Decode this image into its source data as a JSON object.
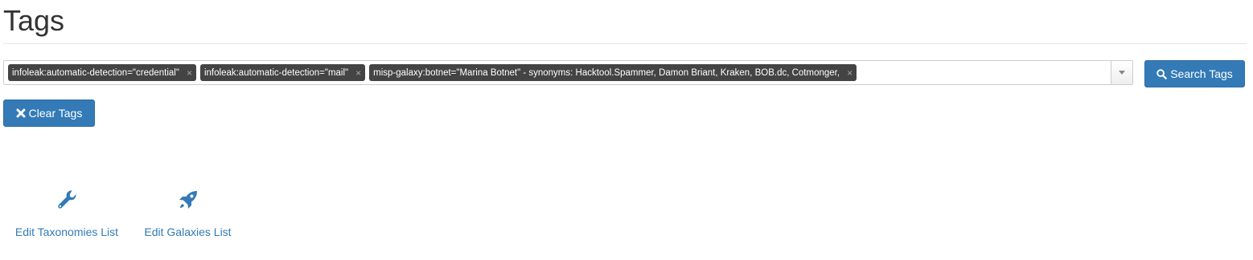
{
  "page": {
    "title": "Tags"
  },
  "tag_select": {
    "tags": [
      {
        "label": "infoleak:automatic-detection=\"credential\"",
        "remove_symbol": "×"
      },
      {
        "label": "infoleak:automatic-detection=\"mail\"",
        "remove_symbol": "×"
      },
      {
        "label": "misp-galaxy:botnet=\"Marina Botnet\" - synonyms: Hacktool.Spammer, Damon Briant, Kraken, BOB.dc, Cotmonger,",
        "remove_symbol": "×"
      }
    ],
    "dropdown_icon": "caret-down-icon"
  },
  "buttons": {
    "search": {
      "label": "Search Tags",
      "icon": "search-icon"
    },
    "clear": {
      "label": "Clear Tags",
      "icon": "close-icon"
    }
  },
  "links": {
    "taxonomies": {
      "label": "Edit Taxonomies List",
      "icon": "wrench-icon"
    },
    "galaxies": {
      "label": "Edit Galaxies List",
      "icon": "rocket-icon"
    }
  },
  "colors": {
    "primary": "#337ab7",
    "tag_chip": "#444444",
    "text": "#333333"
  }
}
